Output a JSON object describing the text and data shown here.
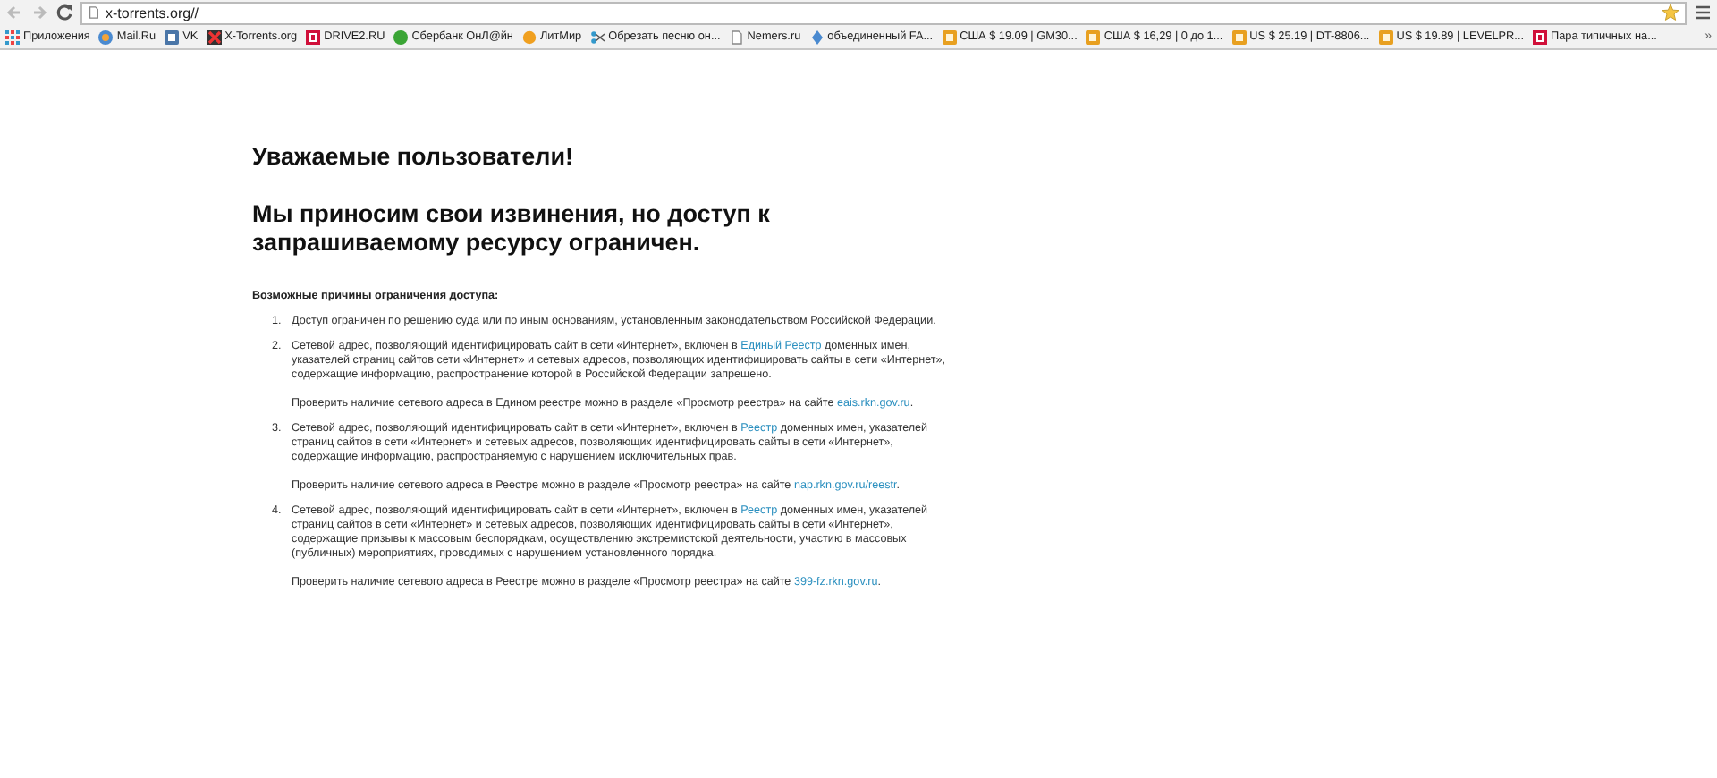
{
  "browser": {
    "address": "x-torrents.org//",
    "bookmarks": [
      {
        "kind": "apps",
        "label": "Приложения"
      },
      {
        "kind": "mail",
        "label": "Mail.Ru"
      },
      {
        "kind": "vk",
        "label": "VK"
      },
      {
        "kind": "cross",
        "label": "X-Torrents.org"
      },
      {
        "kind": "letter",
        "label": "DRIVE2.RU"
      },
      {
        "kind": "ball",
        "label": "Сбербанк ОнЛ@йн"
      },
      {
        "kind": "sun",
        "label": "ЛитМир"
      },
      {
        "kind": "cut",
        "label": "Обрезать песню он..."
      },
      {
        "kind": "page",
        "label": "Nemers.ru"
      },
      {
        "kind": "diamond",
        "label": "объединенный FA..."
      },
      {
        "kind": "folder",
        "label": "США $ 19.09 | GM30..."
      },
      {
        "kind": "folder",
        "label": "США $ 16,29 | 0 до 1..."
      },
      {
        "kind": "folder",
        "label": "US $ 25.19 | DT-8806..."
      },
      {
        "kind": "folder",
        "label": "US $ 19.89 | LEVELPR..."
      },
      {
        "kind": "letter",
        "label": "Пара типичных на..."
      }
    ],
    "overflow": "»"
  },
  "page": {
    "greeting": "Уважаемые пользователи!",
    "message": "Мы приносим свои извинения, но доступ к запрашиваемому ресурсу ограничен.",
    "reasons_title": "Возможные причины ограничения доступа:",
    "reasons": [
      {
        "number": "1.",
        "text": {
          "before": "Доступ ограничен  по решению суда или по иным основаниям, установленным законодательством Российской Федерации."
        }
      },
      {
        "number": "2.",
        "text": {
          "before": "Сетевой адрес, позволяющий идентифицировать сайт в сети «Интернет», включен в ",
          "link": "Единый Реестр",
          "after": " доменных имен, указателей страниц сайтов сети «Интернет» и сетевых адресов, позволяющих идентифицировать сайты в сети «Интернет», содержащие информацию, распространение которой в Российской Федерации запрещено."
        },
        "check": {
          "before": "Проверить наличие сетевого адреса в Едином реестре можно в разделе «Просмотр реестра» на сайте ",
          "link": "eais.rkn.gov.ru",
          "after": "."
        }
      },
      {
        "number": "3.",
        "text": {
          "before": "Сетевой адрес, позволяющий идентифицировать сайт в сети «Интернет», включен в ",
          "link": "Реестр",
          "after": " доменных имен, указателей страниц сайтов в сети «Интернет» и сетевых адресов, позволяющих идентифицировать сайты в сети «Интернет», содержащие информацию, распространяемую с нарушением исключительных прав."
        },
        "check": {
          "before": "Проверить наличие сетевого адреса в Реестре можно в разделе «Просмотр реестра» на сайте ",
          "link": "nap.rkn.gov.ru/reestr",
          "after": "."
        }
      },
      {
        "number": "4.",
        "text": {
          "before": "Сетевой адрес, позволяющий идентифицировать сайт в сети «Интернет», включен в ",
          "link": "Реестр",
          "after": " доменных имен, указателей страниц сайтов в сети «Интернет» и сетевых адресов, позволяющих идентифицировать сайты в сети «Интернет», содержащие призывы к массовым беспорядкам, осуществлению экстремистской деятельности, участию в массовых (публичных) мероприятиях, проводимых с нарушением установленного порядка."
        },
        "check": {
          "before": "Проверить наличие сетевого адреса в Реестре можно в разделе «Просмотр реестра» на сайте ",
          "link": "399-fz.rkn.gov.ru",
          "after": "."
        }
      }
    ]
  }
}
